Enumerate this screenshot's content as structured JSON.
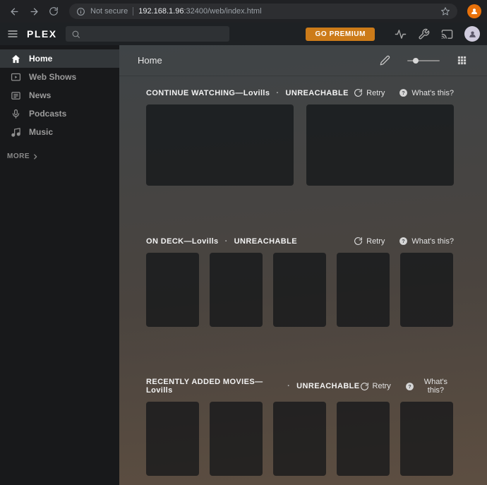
{
  "browser": {
    "security_badge": "Not secure",
    "url_host": "192.168.1.96",
    "url_path": ":32400/web/index.html"
  },
  "navbar": {
    "logo": "PLEX",
    "search": {
      "value": "",
      "placeholder": ""
    },
    "premium_button_label": "GO PREMIUM"
  },
  "sidebar": {
    "items": [
      {
        "label": "Home",
        "active": true
      },
      {
        "label": "Web Shows",
        "active": false
      },
      {
        "label": "News",
        "active": false
      },
      {
        "label": "Podcasts",
        "active": false
      },
      {
        "label": "Music",
        "active": false
      }
    ],
    "more_label": "MORE"
  },
  "content_header": {
    "title": "Home"
  },
  "sections": [
    {
      "title": "CONTINUE WATCHING—Lovills",
      "separator": "·",
      "status": "UNREACHABLE",
      "retry_label": "Retry",
      "whats_this_label": "What's this?",
      "card_type": "landscape",
      "card_count": 2
    },
    {
      "title": "ON DECK—Lovills",
      "separator": "·",
      "status": "UNREACHABLE",
      "retry_label": "Retry",
      "whats_this_label": "What's this?",
      "card_type": "portrait",
      "card_count": 5
    },
    {
      "title": "RECENTLY ADDED MOVIES—Lovills",
      "separator": "·",
      "status": "UNREACHABLE",
      "retry_label": "Retry",
      "whats_this_label": "What's this?",
      "card_type": "portrait",
      "card_count": 5
    }
  ],
  "icons": {
    "browser": [
      "back-icon",
      "forward-icon",
      "refresh-icon",
      "info-icon",
      "star-icon",
      "profile-person-icon"
    ],
    "navbar": [
      "menu-icon",
      "search-icon",
      "activity-icon",
      "tools-icon",
      "cast-icon",
      "user-person-icon"
    ],
    "sidebar": [
      "home-icon",
      "web-shows-icon",
      "news-icon",
      "podcasts-icon",
      "music-icon",
      "chevron-right-icon"
    ],
    "content": [
      "edit-icon",
      "size-slider",
      "grid-icon",
      "retry-icon",
      "help-icon"
    ]
  },
  "colors": {
    "accent_orange": "#cc7b19",
    "background_top": "#3f4447",
    "background_bottom": "#5d4e41",
    "sidebar_active": "#33373a"
  }
}
